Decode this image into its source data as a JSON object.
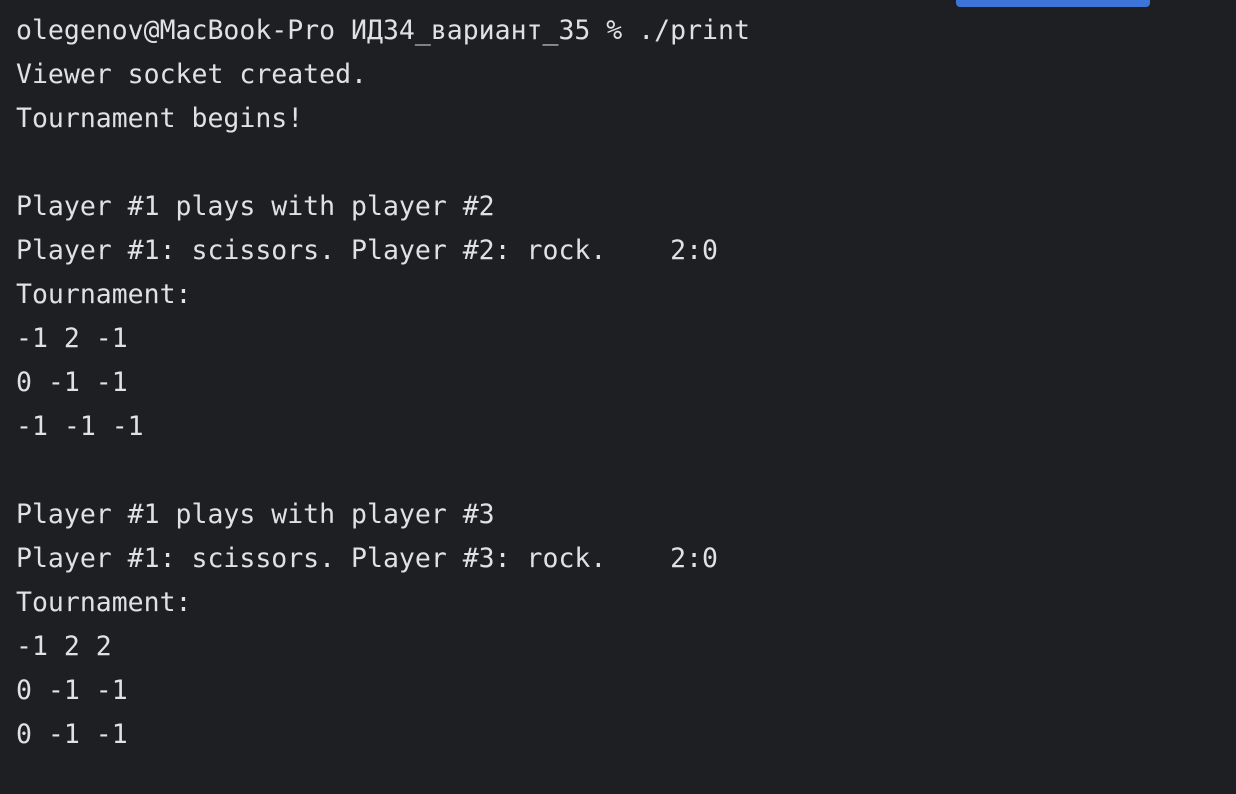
{
  "colors": {
    "background": "#1e1f22",
    "text": "#dfe1e5",
    "tab_indicator": "#3d74d8"
  },
  "terminal": {
    "lines": [
      "olegenov@MacBook-Pro ИД34_вариант_35 % ./print",
      "Viewer socket created.",
      "Tournament begins!",
      "",
      "Player #1 plays with player #2",
      "Player #1: scissors. Player #2: rock.    2:0",
      "Tournament:",
      "-1 2 -1",
      "0 -1 -1",
      "-1 -1 -1",
      "",
      "Player #1 plays with player #3",
      "Player #1: scissors. Player #3: rock.    2:0",
      "Tournament:",
      "-1 2 2",
      "0 -1 -1",
      "0 -1 -1"
    ]
  }
}
